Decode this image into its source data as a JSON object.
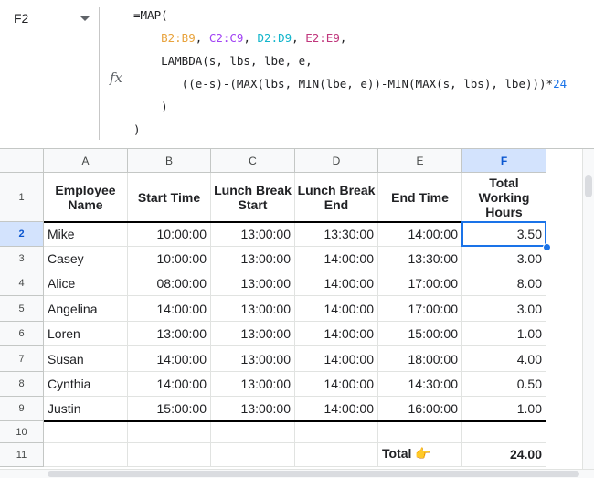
{
  "name_box": {
    "ref": "F2"
  },
  "formula_bar": {
    "fx_label": "fx",
    "line1": "=MAP(",
    "ranges": [
      "B2:B9",
      "C2:C9",
      "D2:D9",
      "E2:E9"
    ],
    "sep": ", ",
    "line3": "LAMBDA(s, lbs, lbe, e,",
    "line4_expr": "((e-s)-(MAX(lbs, MIN(lbe, e))-MIN(MAX(s, lbs), lbe)))*",
    "line4_num": "24",
    "line5": ")",
    "line6": ")",
    "colors": {
      "range1": "#e8a33d",
      "range2": "#a142f4",
      "range3": "#12b5cb",
      "range4": "#c0367c",
      "number": "#1a73e8"
    }
  },
  "columns": [
    "A",
    "B",
    "C",
    "D",
    "E",
    "F"
  ],
  "selected_column": "F",
  "rows": [
    "1",
    "2",
    "3",
    "4",
    "5",
    "6",
    "7",
    "8",
    "9",
    "10",
    "11"
  ],
  "selected_row": "2",
  "headers": [
    "Employee Name",
    "Start Time",
    "Lunch Break Start",
    "Lunch Break End",
    "End Time",
    "Total Working Hours"
  ],
  "data": [
    [
      "Mike",
      "10:00:00",
      "13:00:00",
      "13:30:00",
      "14:00:00",
      "3.50"
    ],
    [
      "Casey",
      "10:00:00",
      "13:00:00",
      "14:00:00",
      "13:30:00",
      "3.00"
    ],
    [
      "Alice",
      "08:00:00",
      "13:00:00",
      "14:00:00",
      "17:00:00",
      "8.00"
    ],
    [
      "Angelina",
      "14:00:00",
      "13:00:00",
      "14:00:00",
      "17:00:00",
      "3.00"
    ],
    [
      "Loren",
      "13:00:00",
      "13:00:00",
      "14:00:00",
      "15:00:00",
      "1.00"
    ],
    [
      "Susan",
      "14:00:00",
      "13:00:00",
      "14:00:00",
      "18:00:00",
      "4.00"
    ],
    [
      "Cynthia",
      "14:00:00",
      "13:00:00",
      "14:00:00",
      "14:30:00",
      "0.50"
    ],
    [
      "Justin",
      "15:00:00",
      "13:00:00",
      "14:00:00",
      "16:00:00",
      "1.00"
    ]
  ],
  "total": {
    "label": "Total 👉",
    "value": "24.00"
  },
  "selection_color": "#1a73e8"
}
